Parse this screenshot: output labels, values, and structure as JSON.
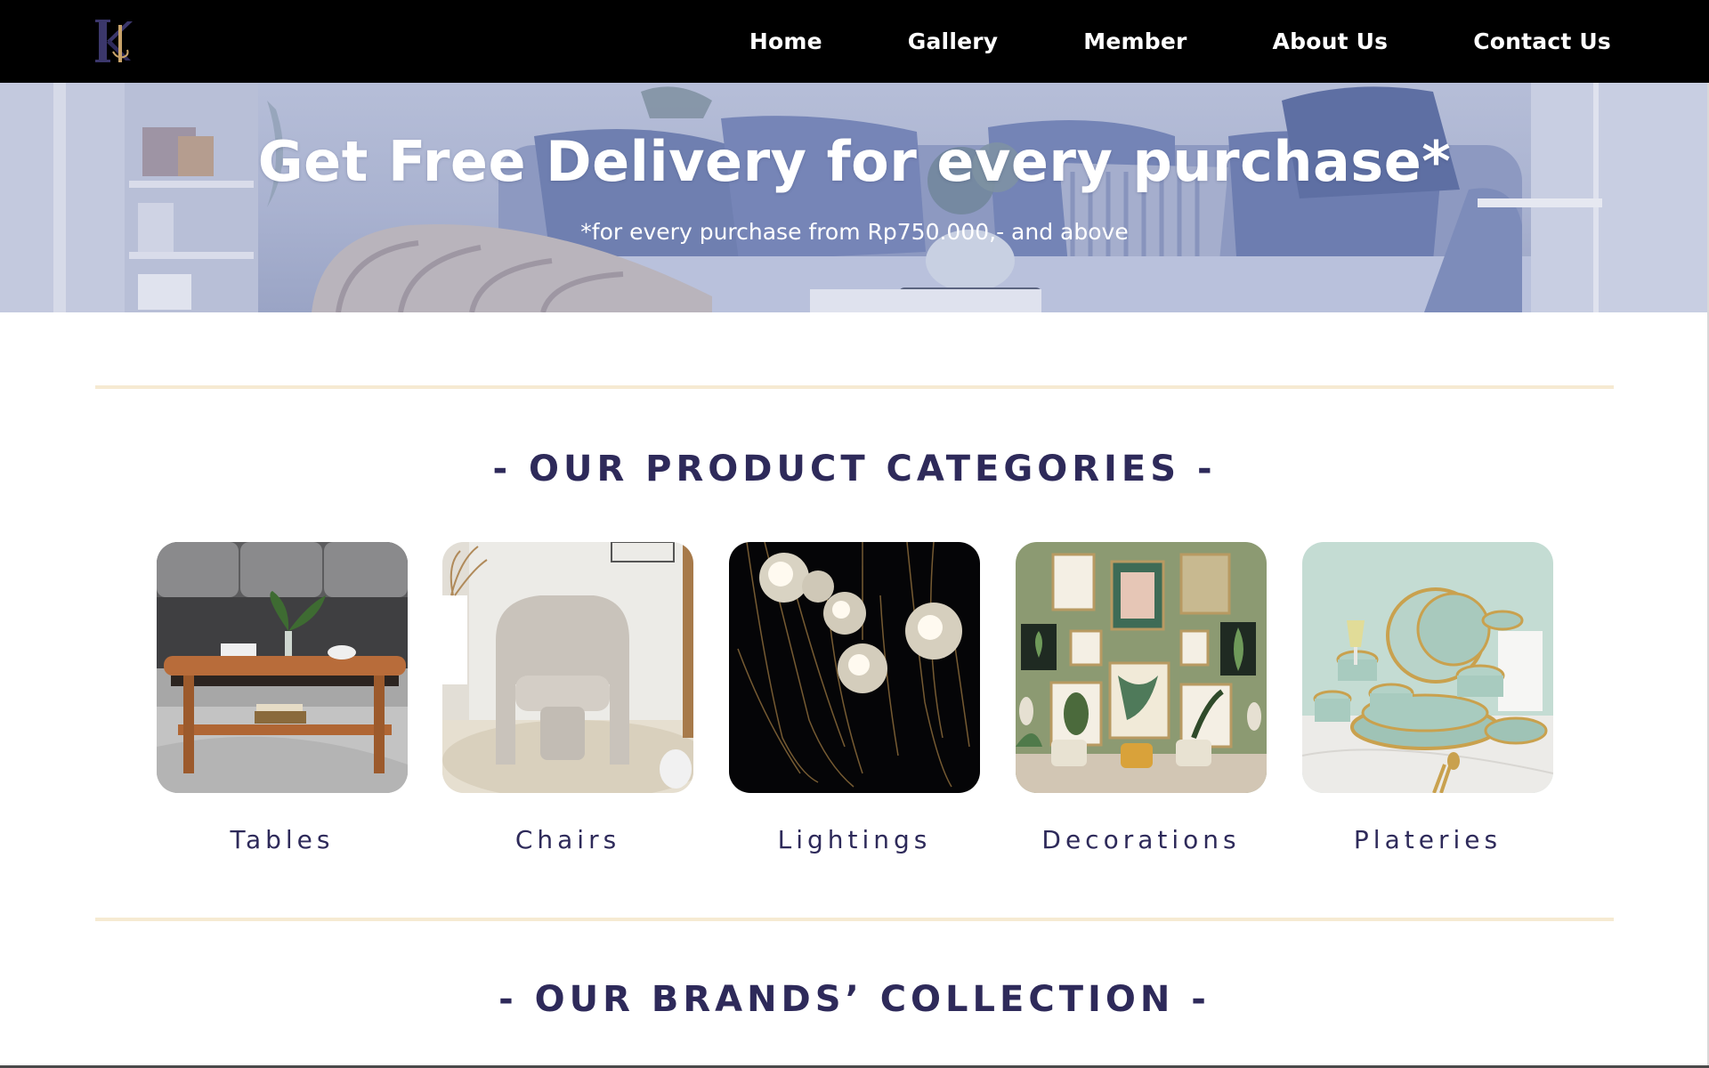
{
  "nav": {
    "logo_icon": "kh-monogram-logo",
    "links": [
      {
        "label": "Home"
      },
      {
        "label": "Gallery"
      },
      {
        "label": "Member"
      },
      {
        "label": "About Us"
      },
      {
        "label": "Contact Us"
      }
    ]
  },
  "hero": {
    "title": "Get Free Delivery for every purchase*",
    "subtitle": "*for every purchase from Rp750.000,- and above"
  },
  "categories": {
    "title": "- OUR PRODUCT CATEGORIES -",
    "items": [
      {
        "label": "Tables",
        "icon": "table-photo"
      },
      {
        "label": "Chairs",
        "icon": "chair-photo"
      },
      {
        "label": "Lightings",
        "icon": "lighting-photo"
      },
      {
        "label": "Decorations",
        "icon": "decoration-photo"
      },
      {
        "label": "Plateries",
        "icon": "platery-photo"
      }
    ]
  },
  "brands": {
    "title": "- OUR BRANDS’ COLLECTION -"
  },
  "colors": {
    "nav_bg": "#000000",
    "accent_text": "#2e2a5a",
    "divider": "#f6ead2",
    "hero_tint": "#a9b2d0"
  }
}
